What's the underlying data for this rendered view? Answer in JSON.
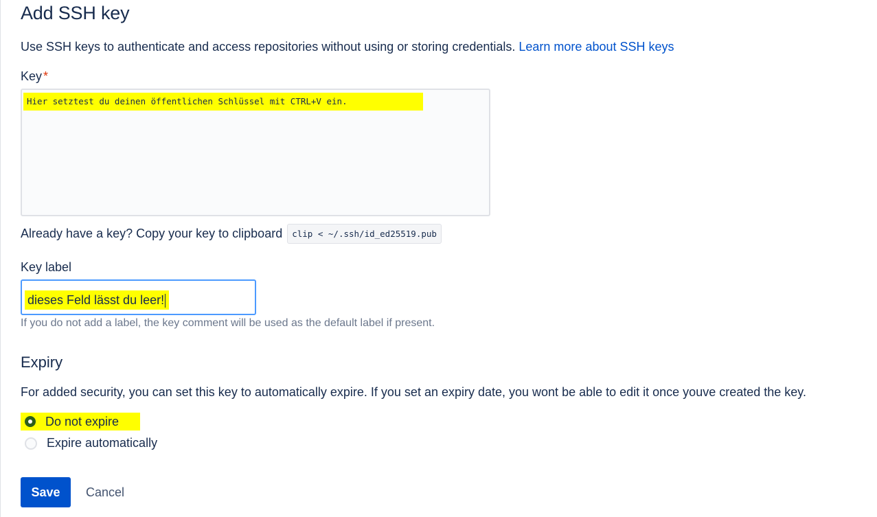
{
  "page": {
    "title": "Add SSH key",
    "intro_text": "Use SSH keys to authenticate and access repositories without using or storing credentials.",
    "learn_more_link": "Learn more about SSH keys"
  },
  "key_field": {
    "label": "Key",
    "required_marker": "*",
    "value": "Hier setztest du deinen öffentlichen Schlüssel mit CTRL+V ein.",
    "clipboard_prompt": "Already have a key? Copy your key to clipboard",
    "clipboard_command": "clip < ~/.ssh/id_ed25519.pub"
  },
  "key_label_field": {
    "label": "Key label",
    "value": "dieses Feld lässt du leer!",
    "help_text": "If you do not add a label, the key comment will be used as the default label if present."
  },
  "expiry": {
    "title": "Expiry",
    "description": "For added security, you can set this key to automatically expire. If you set an expiry date, you wont be able to edit it once youve created the key.",
    "options": [
      {
        "label": "Do not expire",
        "selected": true
      },
      {
        "label": "Expire automatically",
        "selected": false
      }
    ]
  },
  "actions": {
    "save_label": "Save",
    "cancel_label": "Cancel"
  },
  "colors": {
    "primary": "#0052cc",
    "highlight": "#ffff00",
    "required": "#de350b",
    "focus_border": "#4c9aff"
  }
}
